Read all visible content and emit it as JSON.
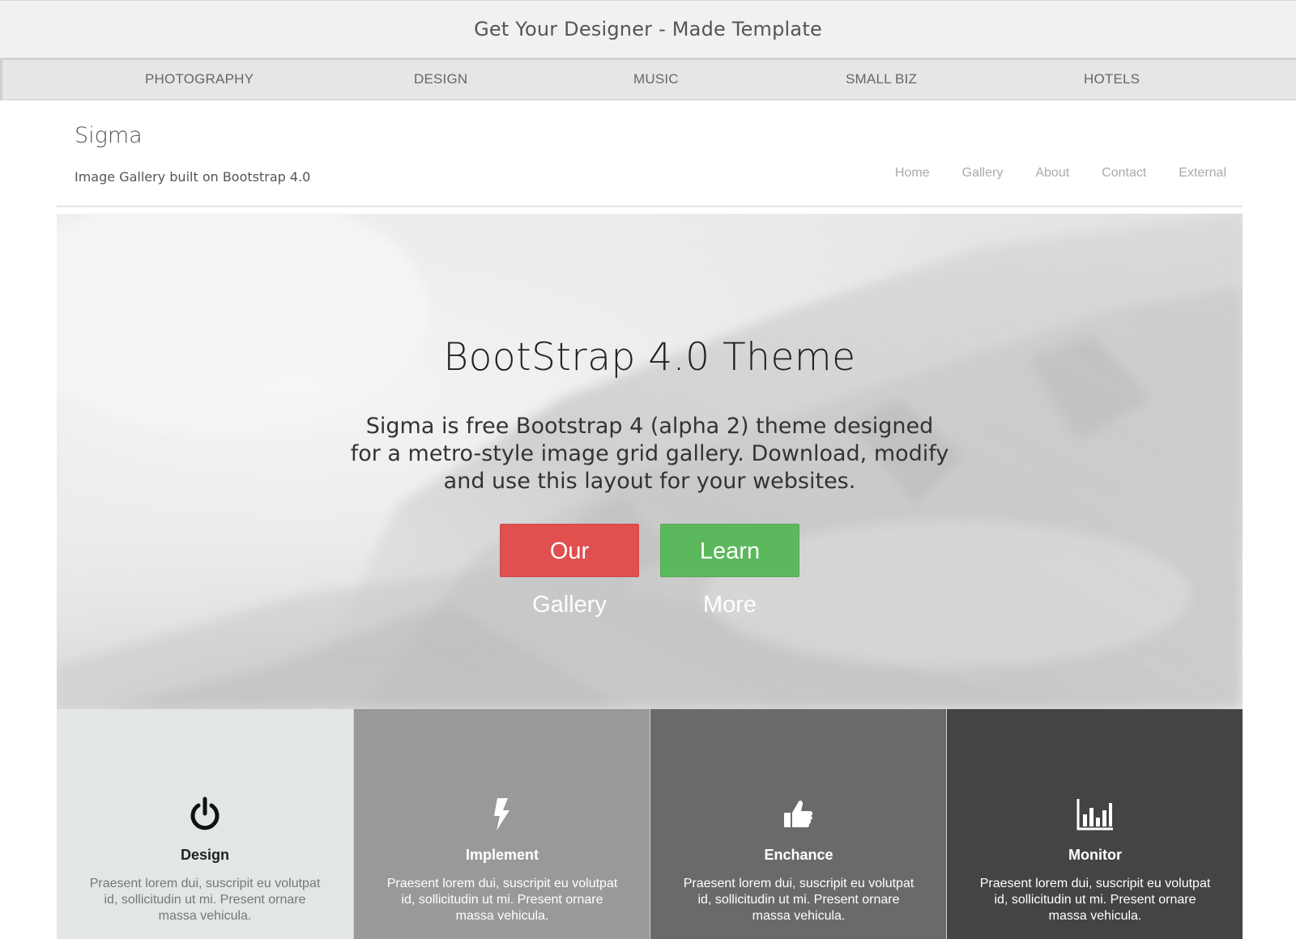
{
  "promo": {
    "title": "Get Your Designer - Made Template"
  },
  "category_nav": {
    "items": [
      {
        "label": "PHOTOGRAPHY"
      },
      {
        "label": "DESIGN"
      },
      {
        "label": "MUSIC"
      },
      {
        "label": "SMALL BIZ"
      },
      {
        "label": "HOTELS"
      }
    ]
  },
  "header": {
    "brand": "Sigma",
    "tagline": "Image Gallery built on Bootstrap 4.0",
    "nav": [
      {
        "label": "Home"
      },
      {
        "label": "Gallery"
      },
      {
        "label": "About"
      },
      {
        "label": "Contact"
      },
      {
        "label": "External"
      }
    ]
  },
  "hero": {
    "title": "BootStrap 4.0 Theme",
    "text": "Sigma is free Bootstrap 4 (alpha 2) theme designed for a metro-style image grid gallery. Download, modify and use this layout for your websites.",
    "primary_button": "Our Gallery",
    "secondary_button": "Learn More"
  },
  "features": [
    {
      "title": "Design",
      "icon": "power-icon",
      "text": "Praesent lorem dui, suscripit eu volutpat id, sollicitudin ut mi. Present ornare massa vehicula."
    },
    {
      "title": "Implement",
      "icon": "bolt-icon",
      "text": "Praesent lorem dui, suscripit eu volutpat id, sollicitudin ut mi. Present ornare massa vehicula."
    },
    {
      "title": "Enchance",
      "icon": "thumbs-up-icon",
      "text": "Praesent lorem dui, suscripit eu volutpat id, sollicitudin ut mi. Present ornare massa vehicula."
    },
    {
      "title": "Monitor",
      "icon": "bar-chart-icon",
      "text": "Praesent lorem dui, suscripit eu volutpat id, sollicitudin ut mi. Present ornare massa vehicula."
    }
  ],
  "colors": {
    "primary_button": "#e0504f",
    "secondary_button": "#5cb85c",
    "feature_backgrounds": [
      "#e3e6e7",
      "#999999",
      "#6a6a6a",
      "#444444"
    ]
  }
}
